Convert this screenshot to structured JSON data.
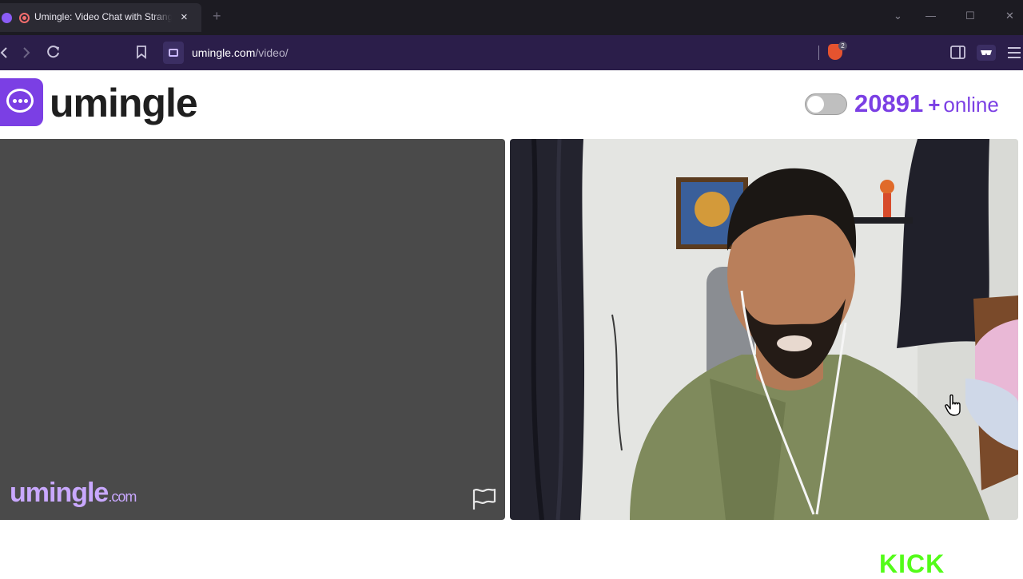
{
  "browser": {
    "tab_title": "Umingle: Video Chat with Strangers",
    "tab_close": "×",
    "new_tab": "+",
    "url_domain": "umingle.com",
    "url_path": "/video/",
    "brave_badge": "2",
    "window_controls": [
      "⌄",
      "—",
      "☐",
      "✕"
    ]
  },
  "header": {
    "brand": "umingle",
    "online_count": "20891",
    "online_plus": "+",
    "online_label": "online",
    "toggle_on": false
  },
  "video": {
    "watermark_main": "umingle",
    "watermark_tld": ".com"
  },
  "overlay": {
    "kick_logo": "KICK"
  },
  "colors": {
    "brand": "#7b3fe4",
    "nav_bg": "#2b1e4a",
    "tab_bg": "#1c1b22",
    "kick": "#53fc18"
  },
  "icons": [
    "back-icon",
    "forward-icon",
    "reload-icon",
    "bookmark-icon",
    "video-site-icon",
    "brave-shield-icon",
    "sidebar-icon",
    "wallet-icon",
    "menu-icon",
    "report-flag-icon"
  ]
}
